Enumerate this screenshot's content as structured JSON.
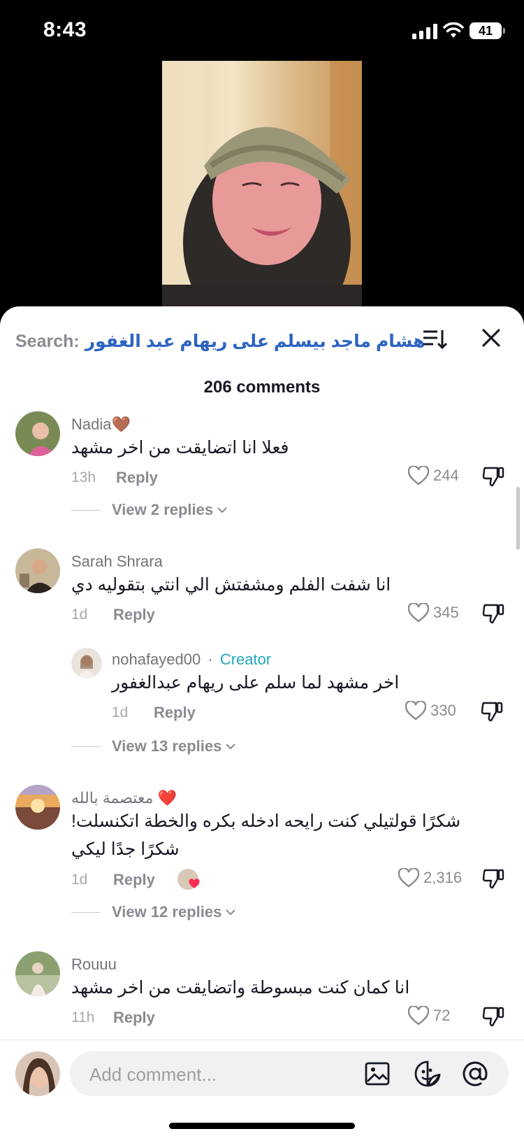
{
  "status": {
    "time": "8:43",
    "battery": "41"
  },
  "search": {
    "prefix": "Search:",
    "query": "هشام ماجد بيسلم على ريهام عبد الغفور"
  },
  "comments_count": "206 comments",
  "comments": [
    {
      "name": "Nadia🤎",
      "text": "فعلا انا اتضايقت من اخر مشهد",
      "time": "13h",
      "reply": "Reply",
      "likes": "244",
      "view_replies": "View 2 replies"
    },
    {
      "name": "Sarah Shrara",
      "text": "انا شفت الفلم ومشفتش الي انتي بتقوليه دي",
      "time": "1d",
      "reply": "Reply",
      "likes": "345"
    },
    {
      "name": "nohafayed00",
      "badge": "Creator",
      "separator": "·",
      "text": "اخر مشهد لما سلم على ريهام عبدالغفور",
      "time": "1d",
      "reply": "Reply",
      "likes": "330",
      "view_replies": "View 13 replies"
    },
    {
      "name": "معتصمة بالله ❤️",
      "text": "شكرًا قولتيلي كنت رايحه ادخله بكره والخطة اتكنسلت! شكرًا جدًا ليكي",
      "time": "1d",
      "reply": "Reply",
      "likes": "2,316",
      "view_replies": "View 12 replies"
    },
    {
      "name": "Rouuu",
      "text": "انا كمان كنت مبسوطة واتضايقت من اخر مشهد",
      "time": "11h",
      "reply": "Reply",
      "likes": "72"
    }
  ],
  "input": {
    "placeholder": "Add comment..."
  },
  "colors": {
    "accent_link": "#2d64c2",
    "creator": "#20a8bd",
    "heart": "#fe2c55"
  }
}
